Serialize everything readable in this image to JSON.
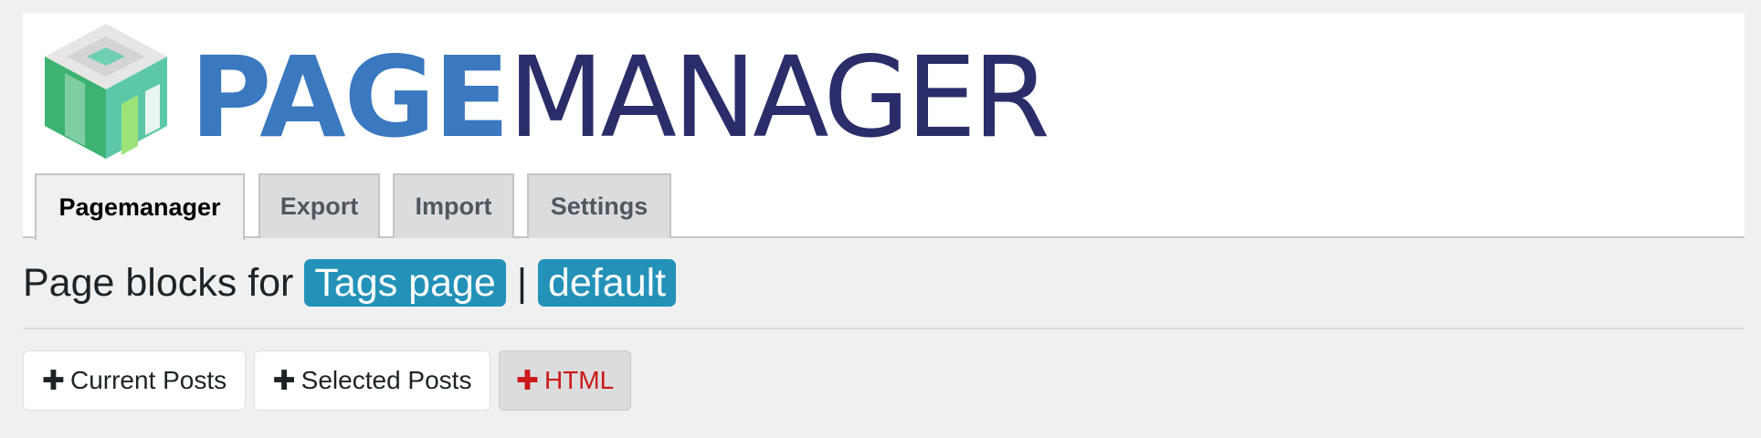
{
  "logo": {
    "bold_text": "PAGE",
    "light_text": "MANAGER",
    "colors": {
      "bold": "#3a78c0",
      "light": "#2b2d6a",
      "cube_green": "#3cb371",
      "cube_teal": "#5cc8a8"
    }
  },
  "tabs": [
    {
      "label": "Pagemanager",
      "active": true
    },
    {
      "label": "Export",
      "active": false
    },
    {
      "label": "Import",
      "active": false
    },
    {
      "label": "Settings",
      "active": false
    }
  ],
  "title": {
    "prefix": "Page blocks for",
    "page_badge": "Tags page",
    "separator": "|",
    "template_badge": "default",
    "badge_color": "#2391b8"
  },
  "buttons": [
    {
      "plus": "✚",
      "label": "Current Posts"
    },
    {
      "plus": "✚",
      "label": "Selected Posts"
    },
    {
      "plus": "✚",
      "label": "HTML"
    }
  ]
}
